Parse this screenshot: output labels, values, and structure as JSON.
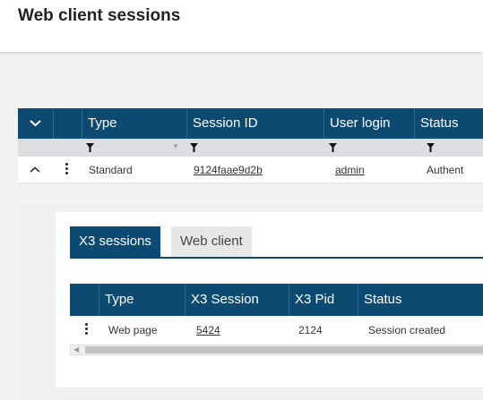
{
  "page": {
    "title": "Web client sessions"
  },
  "grid": {
    "columns": [
      "Type",
      "Session ID",
      "User login",
      "Status"
    ],
    "rows": [
      {
        "type": "Standard",
        "session_id": "9124faae9d2b",
        "user_login": "admin",
        "status": "Authent"
      }
    ]
  },
  "detail": {
    "tabs": [
      "X3 sessions",
      "Web client"
    ],
    "active_tab": "X3 sessions",
    "columns": [
      "Type",
      "X3 Session",
      "X3 Pid",
      "Status"
    ],
    "rows": [
      {
        "type": "Web page",
        "x3_session": "5424",
        "x3_pid": "2124",
        "status": "Session created"
      }
    ]
  },
  "colors": {
    "header": "#0c4a72",
    "filter_row": "#dcdee2",
    "background": "#f2f2f3"
  },
  "icons": [
    "chevron-down-icon",
    "filter-icon",
    "sort-caret-icon",
    "chevron-up-icon",
    "kebab-menu-icon",
    "scroll-left-icon"
  ]
}
